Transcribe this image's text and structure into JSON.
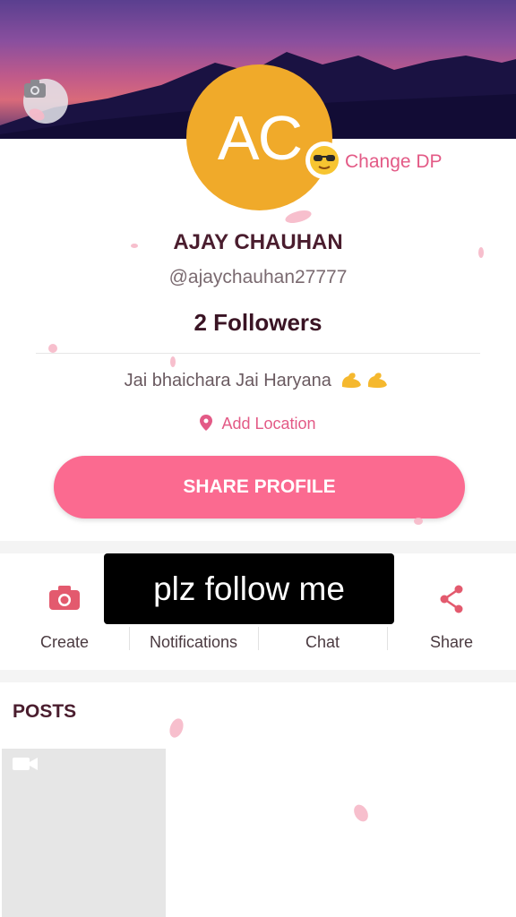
{
  "profile": {
    "initials": "AC",
    "change_dp_label": "Change DP",
    "name": "AJAY CHAUHAN",
    "handle": "@ajaychauhan27777",
    "followers": "2 Followers",
    "bio": "Jai bhaichara Jai Haryana",
    "add_location_label": "Add Location",
    "share_profile_label": "SHARE PROFILE"
  },
  "actions": [
    {
      "label": "Create",
      "icon": "camera-icon"
    },
    {
      "label": "Notifications",
      "icon": "bell-icon"
    },
    {
      "label": "Chat",
      "icon": "chat-icon"
    },
    {
      "label": "Share",
      "icon": "share-icon"
    }
  ],
  "caption": "plz follow me",
  "posts": {
    "title": "POSTS"
  },
  "colors": {
    "accent": "#fb6a90",
    "link": "#e35a86",
    "avatar_bg": "#f0aa2a",
    "name_text": "#4a1d2e"
  }
}
